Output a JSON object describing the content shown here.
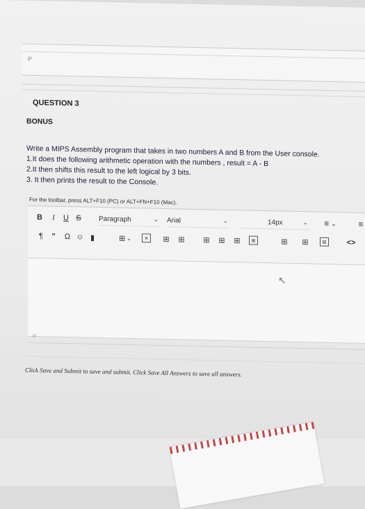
{
  "previous_editor": {
    "paragraph_marker": "P"
  },
  "question": {
    "title": "QUESTION 3",
    "category": "BONUS",
    "line1": "Write a MIPS Assembly program that takes in two numbers A and B from the User console.",
    "line2": "1.It does the following arithmetic operation with the numbers , result = A - B",
    "line3": "2.It then shifts this result to the left logical by 3 bits.",
    "line4": "3. It then prints the result to the Console."
  },
  "toolbar": {
    "hint": "For the toolbar, press ALT+F10 (PC) or ALT+FN+F10 (Mac).",
    "bold": "B",
    "italic": "I",
    "underline": "U",
    "strike": "S",
    "paragraph_select": "Paragraph",
    "font_select": "Arial",
    "size_select": "14px",
    "row2_icons": [
      "pilcrow-icon",
      "quote-icon",
      "omega-icon",
      "emoji-icon",
      "bookmark-icon",
      "table-icon",
      "clear-format-icon",
      "table-props-icon",
      "table-delete-icon",
      "row-before-icon",
      "row-after-icon",
      "row-delete-icon",
      "col-before-icon",
      "col-after-icon",
      "col-delete-icon",
      "split-cell-icon",
      "merge-cell-icon",
      "code-view-icon"
    ]
  },
  "editor": {
    "paragraph_marker": "P"
  },
  "footer": {
    "note": "Click Save and Submit to save and submit. Click Save All Answers to save all answers."
  }
}
